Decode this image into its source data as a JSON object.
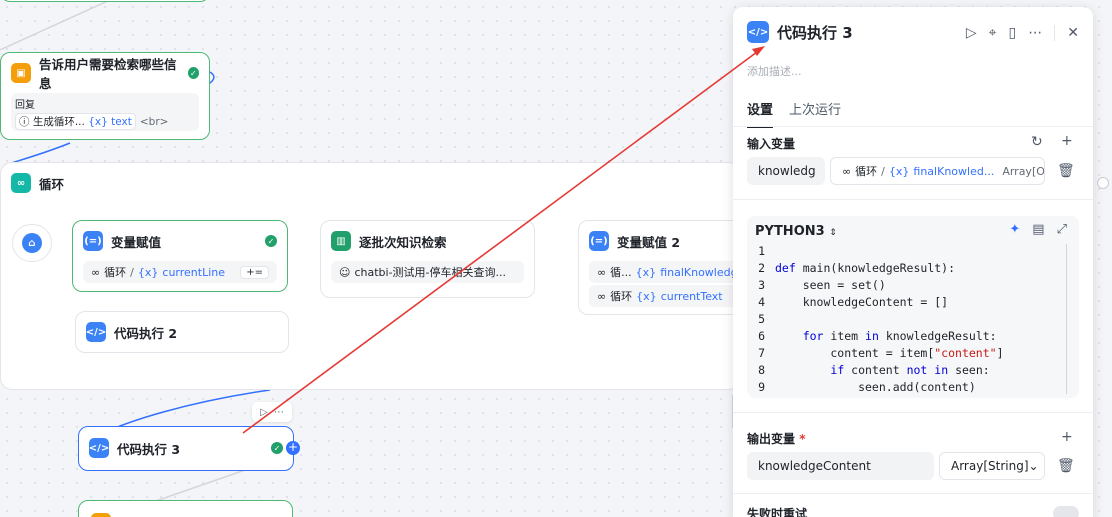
{
  "canvas": {
    "node_tell": {
      "title": "告诉用户需要检索哪些信息",
      "reply_label": "回复",
      "reply_source": "生成循环...",
      "reply_var": "text",
      "reply_tail": "<br>"
    },
    "loop": {
      "title": "循环"
    },
    "assign1": {
      "title": "变量赋值",
      "prefix": "循环",
      "var": "currentLine",
      "op": "+="
    },
    "code2": {
      "title": "代码执行 2"
    },
    "search": {
      "title": "逐批次知识检索",
      "item": "chatbi-测试用-停车相关查询..."
    },
    "assign2": {
      "title": "变量赋值 2",
      "row1_prefix": "循...",
      "row1_var": "finalKnowledgeRe",
      "row2_prefix": "循环",
      "row2_var": "currentText"
    },
    "code3": {
      "title": "代码执行 3"
    }
  },
  "panel": {
    "title": "代码执行 3",
    "description_placeholder": "添加描述...",
    "tabs": [
      {
        "label": "设置",
        "active": true
      },
      {
        "label": "上次运行",
        "active": false
      }
    ],
    "input_section": {
      "label": "输入变量",
      "name": "knowledg",
      "source_prefix": "循环",
      "source_var": "finalKnowled...",
      "source_type": "Array[Obj..."
    },
    "code": {
      "language": "PYTHON3",
      "lines": [
        {
          "n": "1",
          "t": ""
        },
        {
          "n": "2",
          "t": "def main(knowledgeResult):"
        },
        {
          "n": "3",
          "t": "    seen = set()"
        },
        {
          "n": "4",
          "t": "    knowledgeContent = []"
        },
        {
          "n": "5",
          "t": ""
        },
        {
          "n": "6",
          "t": "    for item in knowledgeResult:"
        },
        {
          "n": "7",
          "t": "        content = item[\"content\"]"
        },
        {
          "n": "8",
          "t": "        if content not in seen:"
        },
        {
          "n": "9",
          "t": "            seen.add(content)"
        }
      ]
    },
    "output_section": {
      "label": "输出变量",
      "required_mark": "*",
      "name": "knowledgeContent",
      "type": "Array[String]"
    },
    "retry_label": "失败时重试"
  },
  "colors": {
    "accent": "#3370ff",
    "success": "#22a06b",
    "arrow": "#e53935"
  }
}
